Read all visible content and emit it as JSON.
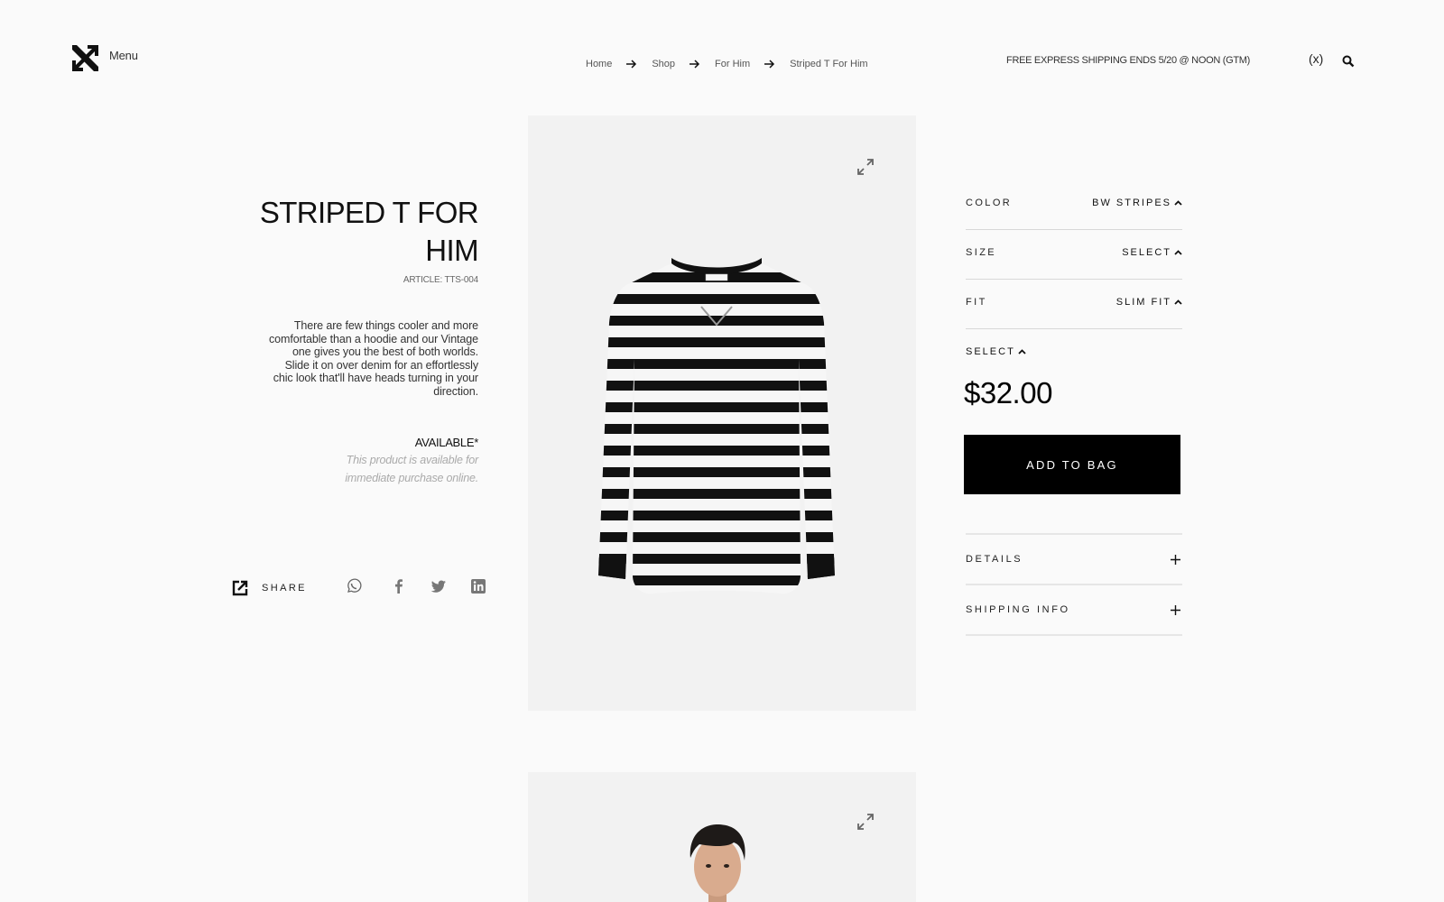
{
  "header": {
    "menu_label": "Menu",
    "promo_text": "FREE EXPRESS SHIPPING ENDS 5/20 @ NOON (GTM)",
    "currency_label": "(x)"
  },
  "breadcrumb": [
    {
      "label": "Home"
    },
    {
      "label": "Shop"
    },
    {
      "label": "For Him"
    },
    {
      "label": "Striped T For Him"
    }
  ],
  "product": {
    "title_line1": "STRIPED T FOR",
    "title_line2": "HIM",
    "article": "ARTICLE: TTS-004",
    "description": "There are few things cooler and more comfortable than a hoodie and our Vintage one gives you the best of both worlds. Slide it on over denim for an effortlessly chic look that'll have heads turning in your direction.",
    "availability_heading": "AVAILABLE*",
    "availability_text": "This product is available for immediate purchase online.",
    "price": "$32.00"
  },
  "share": {
    "label": "SHARE",
    "networks": [
      "whatsapp-icon",
      "facebook-icon",
      "twitter-icon",
      "linkedin-icon"
    ]
  },
  "options": {
    "color_label": "COLOR",
    "color_value": "BW STRIPES",
    "size_label": "SIZE",
    "size_value": "SELECT",
    "fit_label": "FIT",
    "fit_value": "SLIM FIT",
    "quantity_value": "SELECT"
  },
  "cart": {
    "add_label": "ADD TO BAG"
  },
  "accordions": {
    "details_label": "DETAILS",
    "shipping_label": "SHIPPING INFO"
  },
  "colors": {
    "background": "#fafafa",
    "image_panel": "#f2f2f2",
    "button": "#000000",
    "muted_text": "#aaaaaa"
  }
}
